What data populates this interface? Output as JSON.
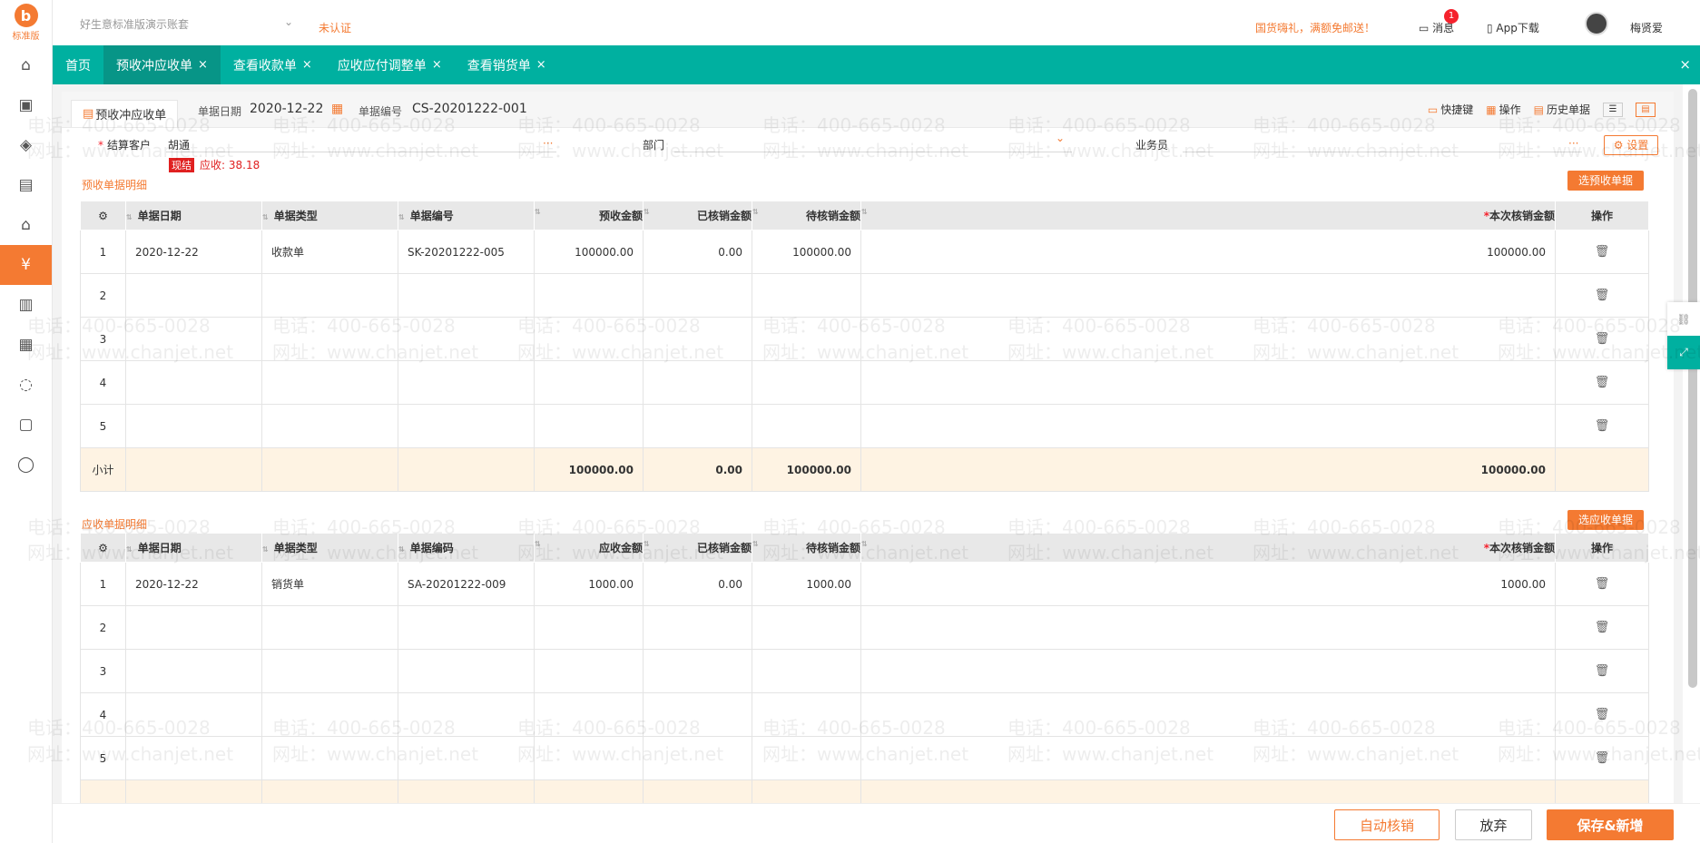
{
  "topbar": {
    "account_name": "好生意标准版演示账套",
    "cert_status": "未认证",
    "promo": "国货嗨礼，满额免邮送！",
    "msg_label": "消息",
    "msg_count": "1",
    "app_download": "App下载",
    "user_name": "梅贤爱"
  },
  "logo": {
    "mark": "b",
    "text": "标准版"
  },
  "tabs": [
    {
      "label": "首页"
    },
    {
      "label": "预收冲应收单"
    },
    {
      "label": "查看收款单"
    },
    {
      "label": "应收应付调整单"
    },
    {
      "label": "查看销货单"
    }
  ],
  "form": {
    "subtab": "预收冲应收单",
    "date_label": "单据日期",
    "date_value": "2020-12-22",
    "no_label": "单据编号",
    "no_value": "CS-20201222-001",
    "tools": [
      "快捷键",
      "操作",
      "历史单据"
    ],
    "customer_label": "结算客户",
    "customer_value": "胡通",
    "dept_label": "部门",
    "sales_label": "业务员",
    "settings": "设置",
    "badge_cash": "现结",
    "receivable_text": "应收: 38.18"
  },
  "prepay": {
    "section": "预收单据明细",
    "select_btn": "选预收单据",
    "headers": [
      "单据日期",
      "单据类型",
      "单据编号",
      "预收金额",
      "已核销金额",
      "待核销金额",
      "本次核销金额",
      "操作"
    ],
    "rows": [
      {
        "idx": "1",
        "date": "2020-12-22",
        "type": "收款单",
        "no": "SK-20201222-005",
        "amt": "100000.00",
        "done": "0.00",
        "pending": "100000.00",
        "now": "100000.00"
      },
      {
        "idx": "2",
        "date": "",
        "type": "",
        "no": "",
        "amt": "",
        "done": "",
        "pending": "",
        "now": ""
      },
      {
        "idx": "3",
        "date": "",
        "type": "",
        "no": "",
        "amt": "",
        "done": "",
        "pending": "",
        "now": ""
      },
      {
        "idx": "4",
        "date": "",
        "type": "",
        "no": "",
        "amt": "",
        "done": "",
        "pending": "",
        "now": ""
      },
      {
        "idx": "5",
        "date": "",
        "type": "",
        "no": "",
        "amt": "",
        "done": "",
        "pending": "",
        "now": ""
      }
    ],
    "subtotal": {
      "label": "小计",
      "amt": "100000.00",
      "done": "0.00",
      "pending": "100000.00",
      "now": "100000.00"
    }
  },
  "receivable": {
    "section": "应收单据明细",
    "select_btn": "选应收单据",
    "headers": [
      "单据日期",
      "单据类型",
      "单据编码",
      "应收金额",
      "已核销金额",
      "待核销金额",
      "本次核销金额",
      "操作"
    ],
    "rows": [
      {
        "idx": "1",
        "date": "2020-12-22",
        "type": "销货单",
        "no": "SA-20201222-009",
        "amt": "1000.00",
        "done": "0.00",
        "pending": "1000.00",
        "now": "1000.00"
      },
      {
        "idx": "2",
        "date": "",
        "type": "",
        "no": "",
        "amt": "",
        "done": "",
        "pending": "",
        "now": ""
      },
      {
        "idx": "3",
        "date": "",
        "type": "",
        "no": "",
        "amt": "",
        "done": "",
        "pending": "",
        "now": ""
      },
      {
        "idx": "4",
        "date": "",
        "type": "",
        "no": "",
        "amt": "",
        "done": "",
        "pending": "",
        "now": ""
      },
      {
        "idx": "5",
        "date": "",
        "type": "",
        "no": "",
        "amt": "",
        "done": "",
        "pending": "",
        "now": ""
      }
    ]
  },
  "bottom": {
    "auto": "自动核销",
    "giveup": "放弃",
    "save": "保存&新增"
  },
  "watermark": {
    "phone": "电话：400-665-0028",
    "site": "网址：www.chanjet.net"
  },
  "colors": {
    "brand": "#f47a32",
    "tabbar": "#00b0a0",
    "active_tab": "#079587",
    "subtotal_bg": "#fef3e3"
  },
  "icons": [
    "home-icon",
    "gift-icon",
    "purchase-icon",
    "bag-icon",
    "warehouse-icon",
    "finance-icon",
    "clipboard-icon",
    "report-icon",
    "cycle-icon",
    "book-icon",
    "chat-icon"
  ]
}
